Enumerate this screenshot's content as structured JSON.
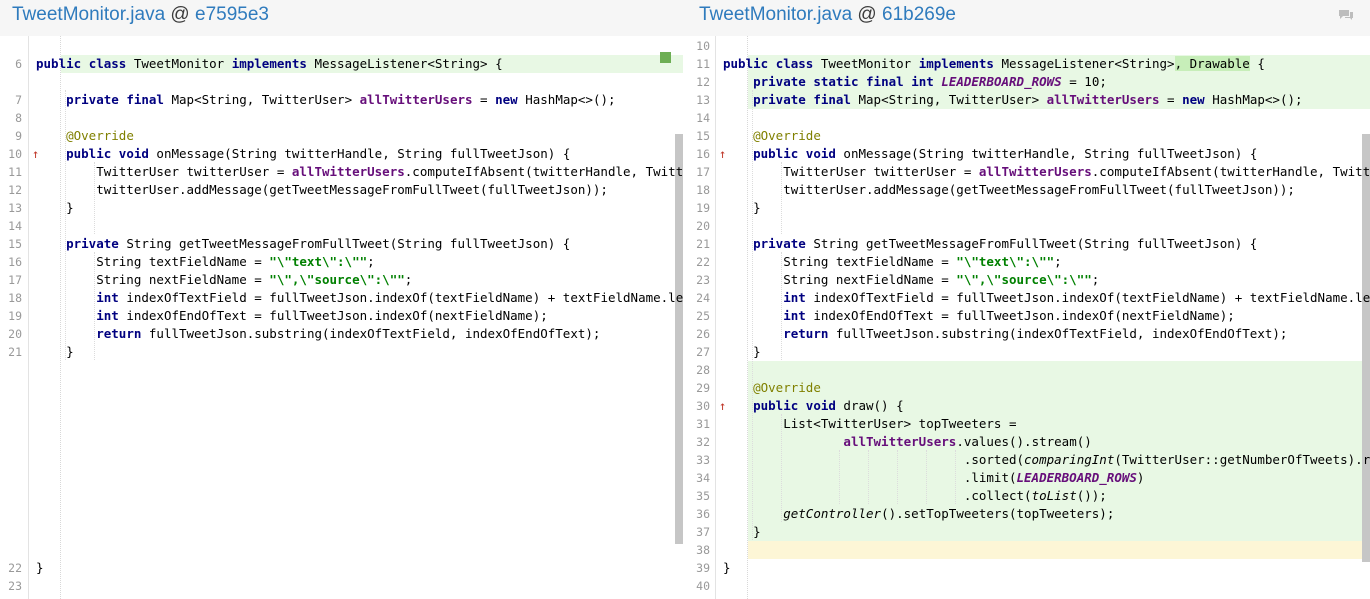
{
  "header": {
    "left": {
      "file": "TweetMonitor.java",
      "at": "@",
      "commit": "e7595e3"
    },
    "right": {
      "file": "TweetMonitor.java",
      "at": "@",
      "commit": "61b269e"
    },
    "icon": "comment-icon"
  },
  "left": {
    "lines": [
      {
        "n": "6",
        "t": "public class TweetMonitor implements MessageListener<String> {"
      },
      {
        "n": "7",
        "t": "    private final Map<String, TwitterUser> allTwitterUsers = new HashMap<>();"
      },
      {
        "n": "8",
        "t": ""
      },
      {
        "n": "9",
        "t": "    @Override"
      },
      {
        "n": "10",
        "t": "    public void onMessage(String twitterHandle, String fullTweetJson) {"
      },
      {
        "n": "11",
        "t": "        TwitterUser twitterUser = allTwitterUsers.computeIfAbsent(twitterHandle, Twitt"
      },
      {
        "n": "12",
        "t": "        twitterUser.addMessage(getTweetMessageFromFullTweet(fullTweetJson));"
      },
      {
        "n": "13",
        "t": "    }"
      },
      {
        "n": "14",
        "t": ""
      },
      {
        "n": "15",
        "t": "    private String getTweetMessageFromFullTweet(String fullTweetJson) {"
      },
      {
        "n": "16",
        "t": "        String textFieldName = \"\\\"text\\\":\\\"\";"
      },
      {
        "n": "17",
        "t": "        String nextFieldName = \"\\\",\\\"source\\\":\\\"\";"
      },
      {
        "n": "18",
        "t": "        int indexOfTextField = fullTweetJson.indexOf(textFieldName) + textFieldName.le"
      },
      {
        "n": "19",
        "t": "        int indexOfEndOfText = fullTweetJson.indexOf(nextFieldName);"
      },
      {
        "n": "20",
        "t": "        return fullTweetJson.substring(indexOfTextField, indexOfEndOfText);"
      },
      {
        "n": "21",
        "t": "    }"
      },
      {
        "n": "22",
        "t": "}"
      },
      {
        "n": "23",
        "t": ""
      }
    ]
  },
  "right": {
    "lines": [
      {
        "n": "10",
        "t": ""
      },
      {
        "n": "11",
        "t": "public class TweetMonitor implements MessageListener<String>, Drawable {"
      },
      {
        "n": "12",
        "t": "    private static final int LEADERBOARD_ROWS = 10;"
      },
      {
        "n": "13",
        "t": "    private final Map<String, TwitterUser> allTwitterUsers = new HashMap<>();"
      },
      {
        "n": "14",
        "t": ""
      },
      {
        "n": "15",
        "t": "    @Override"
      },
      {
        "n": "16",
        "t": "    public void onMessage(String twitterHandle, String fullTweetJson) {"
      },
      {
        "n": "17",
        "t": "        TwitterUser twitterUser = allTwitterUsers.computeIfAbsent(twitterHandle, Twitt"
      },
      {
        "n": "18",
        "t": "        twitterUser.addMessage(getTweetMessageFromFullTweet(fullTweetJson));"
      },
      {
        "n": "19",
        "t": "    }"
      },
      {
        "n": "20",
        "t": ""
      },
      {
        "n": "21",
        "t": "    private String getTweetMessageFromFullTweet(String fullTweetJson) {"
      },
      {
        "n": "22",
        "t": "        String textFieldName = \"\\\"text\\\":\\\"\";"
      },
      {
        "n": "23",
        "t": "        String nextFieldName = \"\\\",\\\"source\\\":\\\"\";"
      },
      {
        "n": "24",
        "t": "        int indexOfTextField = fullTweetJson.indexOf(textFieldName) + textFieldName.le"
      },
      {
        "n": "25",
        "t": "        int indexOfEndOfText = fullTweetJson.indexOf(nextFieldName);"
      },
      {
        "n": "26",
        "t": "        return fullTweetJson.substring(indexOfTextField, indexOfEndOfText);"
      },
      {
        "n": "27",
        "t": "    }"
      },
      {
        "n": "28",
        "t": ""
      },
      {
        "n": "29",
        "t": "    @Override"
      },
      {
        "n": "30",
        "t": "    public void draw() {"
      },
      {
        "n": "31",
        "t": "        List<TwitterUser> topTweeters ="
      },
      {
        "n": "32",
        "t": "                allTwitterUsers.values().stream()"
      },
      {
        "n": "33",
        "t": "                                .sorted(comparingInt(TwitterUser::getNumberOfTweets).re"
      },
      {
        "n": "34",
        "t": "                                .limit(LEADERBOARD_ROWS)"
      },
      {
        "n": "35",
        "t": "                                .collect(toList());"
      },
      {
        "n": "36",
        "t": "        getController().setTopTweeters(topTweeters);"
      },
      {
        "n": "37",
        "t": "    }"
      },
      {
        "n": "38",
        "t": ""
      },
      {
        "n": "39",
        "t": "}"
      },
      {
        "n": "40",
        "t": ""
      }
    ]
  },
  "colors": {
    "added": "#e8f8e4",
    "changed": "#c7eeb9",
    "link": "#2f7bbd",
    "marker": "#6dae54"
  }
}
